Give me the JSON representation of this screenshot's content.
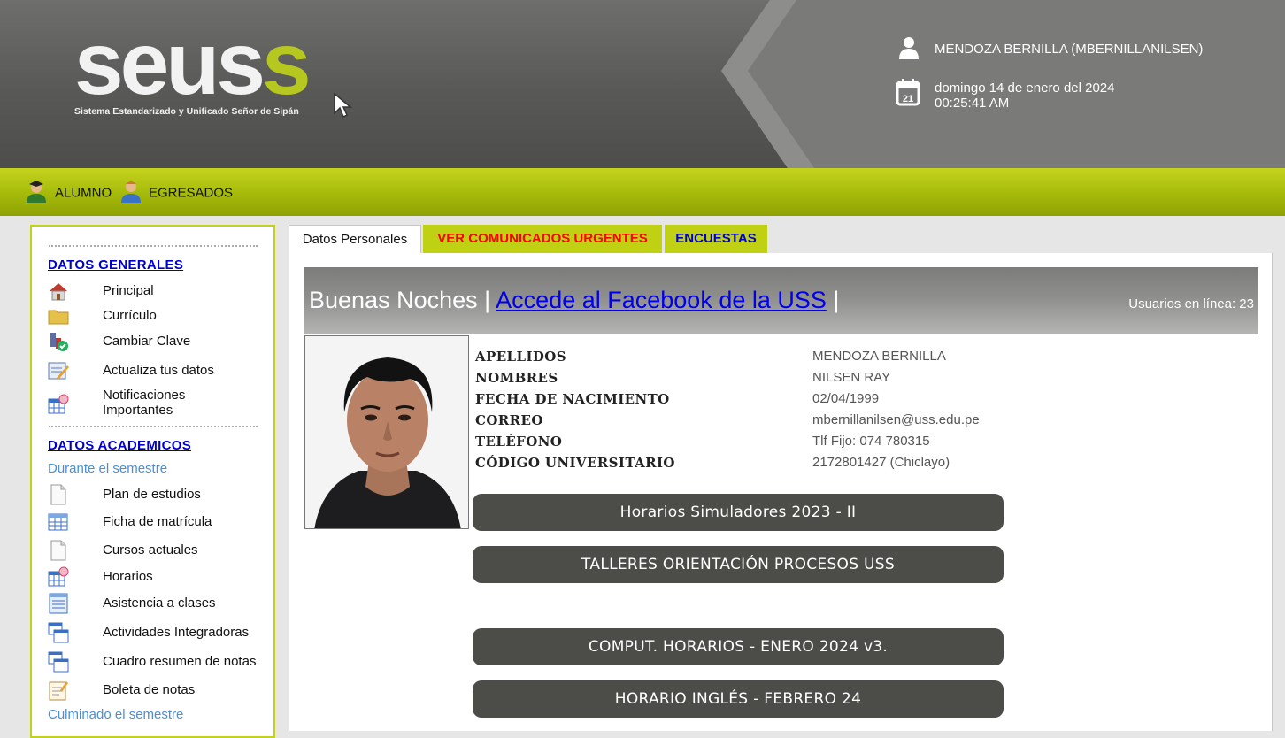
{
  "header": {
    "logo_text": "seuss",
    "logo_subtitle": "Sistema Estandarizado y Unificado Señor de Sipán",
    "user_name": "MENDOZA BERNILLA (MBERNILLANILSEN)",
    "date": "domingo 14 de enero del 2024",
    "time": "00:25:41 AM",
    "calendar_day": "21",
    "user_icon": "user-icon",
    "calendar_icon": "calendar-icon"
  },
  "menu": {
    "items": [
      {
        "label": "ALUMNO",
        "icon": "student-icon"
      },
      {
        "label": "EGRESADOS",
        "icon": "graduate-icon"
      }
    ]
  },
  "sidebar": {
    "section_general": "DATOS GENERALES",
    "general_items": [
      {
        "label": "Principal",
        "icon": "house-icon"
      },
      {
        "label": "Currículo",
        "icon": "folder-icon"
      },
      {
        "label": "Cambiar Clave",
        "icon": "key-icon"
      },
      {
        "label": "Actualiza tus datos",
        "icon": "edit-form-icon"
      },
      {
        "label_line1": "Notificaciones",
        "label_line2": "Importantes",
        "icon": "calendar-alert-icon"
      }
    ],
    "section_academic": "DATOS ACADEMICOS",
    "during_semester": "Durante el semestre",
    "academic_items": [
      {
        "label": "Plan de estudios",
        "icon": "document-icon"
      },
      {
        "label": "Ficha de matrícula",
        "icon": "table-icon"
      },
      {
        "label": "Cursos actuales",
        "icon": "document-icon"
      },
      {
        "label": "Horarios",
        "icon": "calendar-alert-icon"
      },
      {
        "label": "Asistencia a clases",
        "icon": "list-icon"
      },
      {
        "label": "Actividades Integradoras",
        "icon": "windows-icon"
      },
      {
        "label": "Cuadro resumen de notas",
        "icon": "windows-icon"
      },
      {
        "label": "Boleta de notas",
        "icon": "notepad-icon"
      }
    ],
    "after_semester": "Culminado el semestre"
  },
  "tabs": [
    {
      "label": "Datos Personales",
      "color": "#111111"
    },
    {
      "label": "VER COMUNICADOS URGENTES",
      "color": "#ff0000"
    },
    {
      "label": "ENCUESTAS",
      "color": "#0000cc"
    }
  ],
  "main": {
    "greeting": "Buenas Noches",
    "separator": "|",
    "facebook_link": "Accede al Facebook de la USS",
    "online_users": "Usuarios en línea: 23",
    "personal_info": [
      {
        "label": "APELLIDOS",
        "value": "MENDOZA BERNILLA"
      },
      {
        "label": "NOMBRES",
        "value": "NILSEN RAY"
      },
      {
        "label": "FECHA DE NACIMIENTO",
        "value": "02/04/1999"
      },
      {
        "label": "CORREO",
        "value": "mbernillanilsen@uss.edu.pe"
      },
      {
        "label": "TELÉFONO",
        "value": "Tlf Fijo: 074 780315"
      },
      {
        "label": "CÓDIGO UNIVERSITARIO",
        "value": "2172801427 (Chiclayo)"
      }
    ],
    "buttons": [
      "Horarios Simuladores 2023 - II",
      "TALLERES ORIENTACIÓN PROCESOS USS",
      "COMPUT. HORARIOS - ENERO 2024 v3.",
      "HORARIO INGLÉS - FEBRERO 24"
    ]
  },
  "colors": {
    "accent_green": "#b6c81f",
    "header_gray": "#585856",
    "button_dark": "#4c4c48",
    "link_blue": "#0000cc"
  }
}
